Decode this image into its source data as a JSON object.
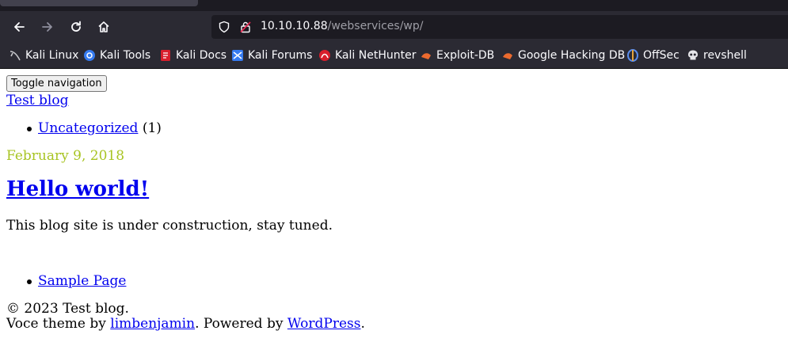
{
  "browser": {
    "url_host": "10.10.10.88",
    "url_path": "/webservices/wp/",
    "bookmarks": [
      {
        "label": "Kali Linux",
        "icon": "kali-dragon-icon"
      },
      {
        "label": "Kali Tools",
        "icon": "kali-tools-icon"
      },
      {
        "label": "Kali Docs",
        "icon": "kali-docs-icon"
      },
      {
        "label": "Kali Forums",
        "icon": "kali-forums-icon"
      },
      {
        "label": "Kali NetHunter",
        "icon": "kali-nethunter-icon"
      },
      {
        "label": "Exploit-DB",
        "icon": "exploit-db-icon"
      },
      {
        "label": "Google Hacking DB",
        "icon": "ghdb-icon"
      },
      {
        "label": "OffSec",
        "icon": "offsec-icon"
      },
      {
        "label": "revshell",
        "icon": "skull-icon"
      }
    ]
  },
  "page": {
    "toggle_label": "Toggle navigation",
    "site_title": "Test blog",
    "categories": [
      {
        "label": "Uncategorized",
        "count": "(1)"
      }
    ],
    "post": {
      "date": "February 9, 2018",
      "title": "Hello world!",
      "body": "This blog site is under construction, stay tuned."
    },
    "pages": [
      {
        "label": "Sample Page"
      }
    ],
    "footer": {
      "copyright": "© 2023 Test blog.",
      "theme_prefix": "Voce theme by ",
      "theme_author": "limbenjamin",
      "powered_prefix": ". Powered by ",
      "powered_link": "WordPress",
      "powered_suffix": "."
    }
  }
}
